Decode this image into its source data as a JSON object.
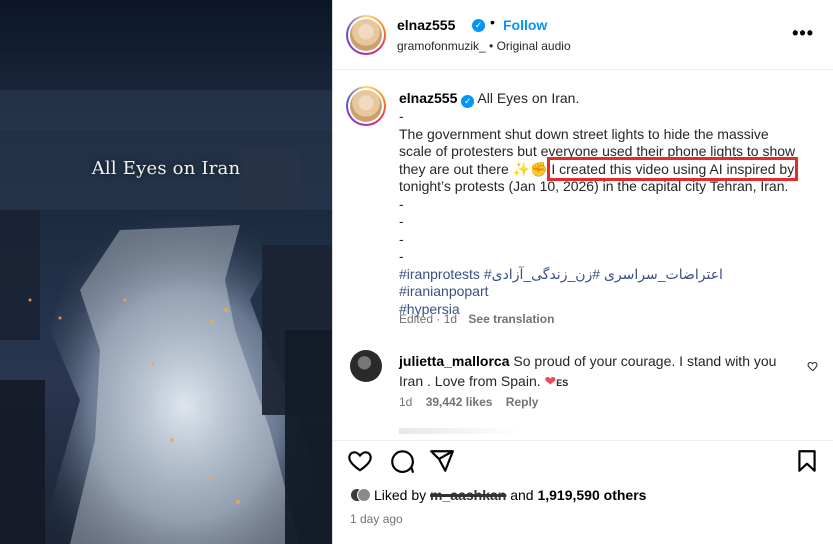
{
  "header": {
    "username": "elnaz555",
    "dot": "•",
    "follow_label": "Follow",
    "sub": "gramofonmuzik_ • Original audio",
    "more": "•••"
  },
  "media": {
    "caption": "All Eyes on Iran"
  },
  "caption": {
    "username": "elnaz555",
    "title": "All Eyes on Iran.",
    "dash": "-",
    "text_1": "The government shut down street lights to hide the massive scale of protesters but everyone used their phone lights to show they are out there",
    "emoji": "✨✊",
    "highlighted": "I created this video using AI inspired by",
    "text_2": "tonight’s protests (Jan 10, 2026) in the capital city Tehran, Iran.",
    "hashtags_line1": "#iranprotests #اعتراضات_سراسری #زن_زندگی_آزادی #iranianpopart",
    "hashtags_line2": "#hypersia",
    "meta_time": "Edited · 1d",
    "see_translation": "See translation"
  },
  "comment": {
    "username": "julietta_mallorca",
    "text": "So proud of your courage. I stand with you Iran . Love from Spain.",
    "heart": "❤",
    "flag": "ES",
    "age": "1d",
    "likes": "39,442 likes",
    "reply": "Reply"
  },
  "footer": {
    "liked_by_prefix": "Liked by",
    "liked_by_user": "m_aashkan",
    "and": "and",
    "others": "1,919,590 others",
    "time_ago": "1 day ago"
  },
  "colors": {
    "accent": "#0095f6",
    "highlight_box": "#e32b2b",
    "hashtag": "#385185",
    "muted": "#737373"
  },
  "icons": [
    "heart-icon",
    "comment-icon",
    "share-icon",
    "bookmark-icon",
    "more-icon",
    "verified-icon"
  ]
}
